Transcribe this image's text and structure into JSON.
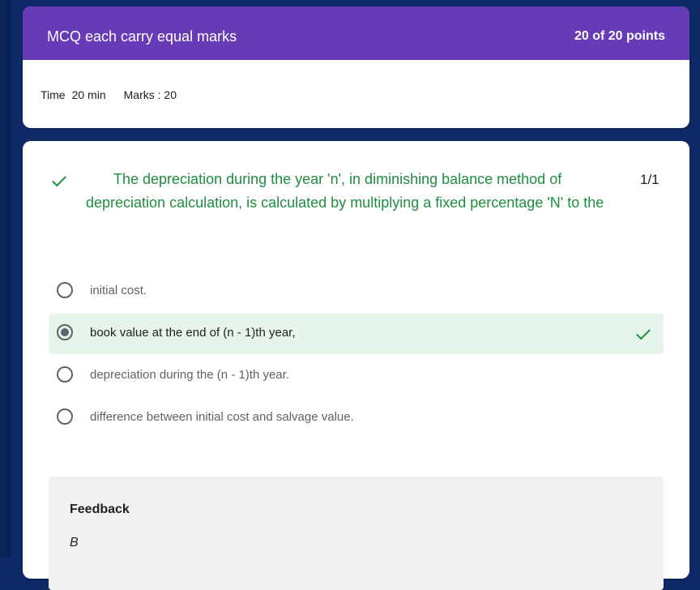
{
  "header": {
    "title": "MCQ each carry equal marks",
    "points": "20 of 20 points",
    "time_label": "Time",
    "time_value": "20 min",
    "marks": "Marks : 20"
  },
  "question": {
    "text": "The depreciation during the year 'n', in diminishing balance method of depreciation calculation, is calculated by multiplying a fixed percentage 'N' to the",
    "score": "1/1",
    "status_icon": "check-icon",
    "options": [
      {
        "label": "initial cost.",
        "selected": false
      },
      {
        "label": "book value at the end of (n - 1)th year,",
        "selected": true,
        "correct": true
      },
      {
        "label": "depreciation during the (n - 1)th year.",
        "selected": false
      },
      {
        "label": "difference between initial cost and salvage value.",
        "selected": false
      }
    ]
  },
  "feedback": {
    "title": "Feedback",
    "text": "B"
  },
  "colors": {
    "accent": "#673ab7",
    "correct": "#1e8e3e",
    "selected_bg": "#e6f4ea",
    "background": "#0d2a66"
  }
}
